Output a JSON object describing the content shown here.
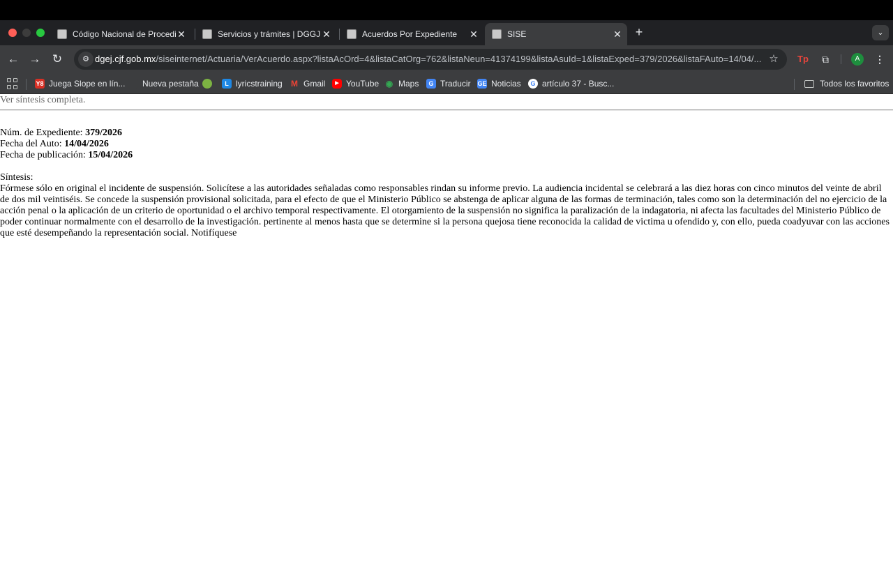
{
  "browser": {
    "tabs": [
      {
        "title": "Código Nacional de Procedimientos",
        "active": false
      },
      {
        "title": "Servicios y trámites | DGGJ",
        "active": false
      },
      {
        "title": "Acuerdos Por Expediente",
        "active": false
      },
      {
        "title": "SISE",
        "active": true
      }
    ],
    "new_tab_label": "+",
    "tab_close_glyph": "✕",
    "url": {
      "host": "dgej.cjf.gob.mx",
      "path": "/siseinternet/Actuaria/VerAcuerdo.aspx?listaAcOrd=4&listaCatOrg=762&listaNeun=41374199&listaAsuId=1&listaExped=379/2026&listaFAuto=14/04/..."
    },
    "profile_initial": "A",
    "extension_label": "Tp",
    "bookmarks": [
      {
        "label": "Juega Slope en lín...",
        "icon": "slope-icon",
        "color": "#d93025"
      },
      {
        "label": "Nueva pestaña",
        "icon": "blank-page-icon",
        "color": "#3c3d3f"
      },
      {
        "label": "",
        "icon": "android-icon",
        "color": "#7cb342"
      },
      {
        "label": "lyricstraining",
        "icon": "lyricstraining-icon",
        "color": "#1e88e5"
      },
      {
        "label": "Gmail",
        "icon": "gmail-icon",
        "color": "#ea4335"
      },
      {
        "label": "YouTube",
        "icon": "youtube-icon",
        "color": "#ff0000"
      },
      {
        "label": "Maps",
        "icon": "maps-icon",
        "color": "#34a853"
      },
      {
        "label": "Traducir",
        "icon": "translate-icon",
        "color": "#4285f4"
      },
      {
        "label": "Noticias",
        "icon": "news-icon",
        "color": "#4285f4"
      },
      {
        "label": "artículo 37 - Busc...",
        "icon": "google-icon",
        "color": "#ffffff"
      }
    ],
    "all_bookmarks_label": "Todos los favoritos"
  },
  "page": {
    "link_full_synthesis": "Ver síntesis completa.",
    "expediente_label": "Núm. de Expediente:",
    "expediente_value": "379/2026",
    "fecha_auto_label": "Fecha del Auto:",
    "fecha_auto_value": "14/04/2026",
    "fecha_pub_label": "Fecha de publicación:",
    "fecha_pub_value": "15/04/2026",
    "sintesis_label": "Síntesis:",
    "sintesis_text": "Fórmese sólo en original el incidente de suspensión. Solicítese a las autoridades señaladas como responsables rindan su informe previo. La audiencia incidental se celebrará a las diez horas con cinco minutos del veinte de abril de dos mil veintiséis. Se concede la suspensión provisional solicitada, para el efecto de que el Ministerio Público se abstenga de aplicar alguna de las formas de terminación, tales como son la determinación del no ejercicio de la acción penal o la aplicación de un criterio de oportunidad o el archivo temporal respectivamente. El otorgamiento de la suspensión no significa la paralización de la indagatoria, ni afecta las facultades del Ministerio Público de poder continuar normalmente con el desarrollo de la investigación. pertinente al menos hasta que se determine si la persona quejosa tiene reconocida la calidad de victima u ofendido y, con ello, pueda coadyuvar con las acciones que esté desempeñando la representación social. Notifíquese"
  }
}
